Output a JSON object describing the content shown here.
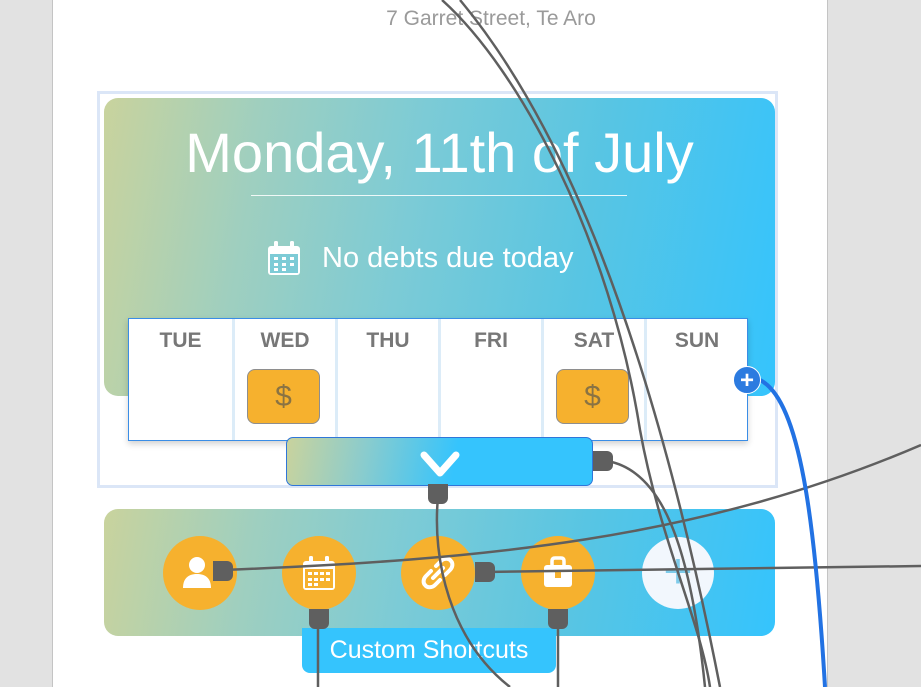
{
  "header": {
    "address": "7 Garret Street, Te Aro"
  },
  "date_card": {
    "title": "Monday, 11th of July",
    "debts_status": "No debts due today",
    "calendar_icon": "calendar-icon"
  },
  "week": {
    "days": [
      {
        "label": "TUE",
        "has_debt": false
      },
      {
        "label": "WED",
        "has_debt": true,
        "badge": "$"
      },
      {
        "label": "THU",
        "has_debt": false
      },
      {
        "label": "FRI",
        "has_debt": false
      },
      {
        "label": "SAT",
        "has_debt": true,
        "badge": "$"
      },
      {
        "label": "SUN",
        "has_debt": false
      }
    ],
    "add_label": "+"
  },
  "expand": {
    "icon": "chevron-down-icon"
  },
  "shortcuts": {
    "label": "Custom Shortcuts",
    "items": [
      {
        "name": "contacts",
        "icon": "person-icon"
      },
      {
        "name": "calendar",
        "icon": "calendar-icon"
      },
      {
        "name": "links",
        "icon": "link-icon"
      },
      {
        "name": "work",
        "icon": "briefcase-icon"
      }
    ],
    "add_label": "+"
  },
  "colors": {
    "accent_orange": "#f6b12e",
    "gradient_start": "#c9d39d",
    "gradient_end": "#35c4fd",
    "wire_gray": "#5f5f5f",
    "wire_blue": "#2272e3"
  }
}
